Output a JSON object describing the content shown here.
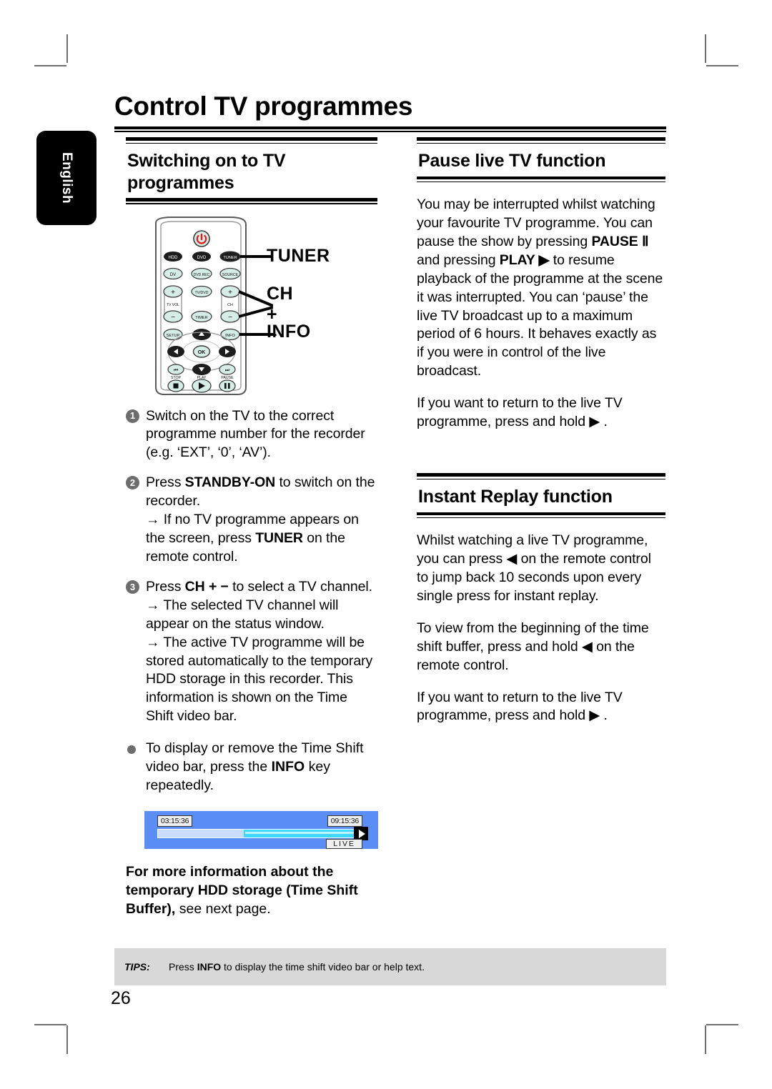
{
  "document": {
    "page_number": "26",
    "language_tab": "English",
    "title": "Control TV programmes"
  },
  "left_column": {
    "section_title": "Switching on to TV programmes",
    "remote": {
      "callouts": [
        "TUNER",
        "CH + −",
        "INFO"
      ],
      "buttons": {
        "row1": [
          "HDD",
          "DVD",
          "TUNER"
        ],
        "row2": [
          "DV",
          "DVD REC",
          "SOURCE"
        ],
        "row3": [
          "+",
          "TV/DVD",
          "+"
        ],
        "row3_labels": [
          "TV VOL",
          "CH"
        ],
        "row4": [
          "−",
          "TIMER",
          "−"
        ],
        "row5": [
          "SETUP",
          "▲",
          "INFO"
        ],
        "nav": [
          "◀",
          "OK",
          "▶"
        ],
        "skip": [
          "⏮",
          "▼",
          "⏭"
        ],
        "transport_labels": [
          "STOP",
          "PLAY",
          "PAUSE"
        ],
        "transport": [
          "■",
          "▶",
          "Ⅱ"
        ]
      }
    },
    "steps": [
      {
        "num": "1",
        "text": "Switch on the TV to the correct programme number for the recorder (e.g. ‘EXT’, ‘0’, ‘AV’)."
      },
      {
        "num": "2",
        "text_parts": {
          "pre": "Press ",
          "bold": "STANDBY-ON",
          "post": " to switch on the recorder."
        },
        "sub": {
          "pre": "→ If no TV programme appears on the screen, press ",
          "bold": "TUNER",
          "post": " on the remote control."
        }
      },
      {
        "num": "3",
        "text_parts": {
          "pre": "Press ",
          "bold": "CH + −",
          "post": " to select a TV channel."
        },
        "sub1": "→ The selected TV channel will appear on the status window.",
        "sub2": "→ The active TV programme will be stored automatically to the temporary HDD storage in this recorder. This information is shown on the Time Shift video bar."
      }
    ],
    "bullet": {
      "pre": "To display or remove the Time Shift video bar, press the ",
      "bold": "INFO",
      "post": " key repeatedly."
    },
    "timeshift_bar": {
      "start_time": "03:15:36",
      "end_time": "09:15:36",
      "live_label": "LIVE",
      "fill_percent": 58,
      "colors": {
        "background": "#5b8ef4",
        "fill": "#3fd8ff",
        "trough": "#c9dcfb"
      }
    },
    "note": {
      "bold": "For more information about the temporary HDD storage (Time Shift Buffer),",
      "normal": " see next page."
    }
  },
  "right_column": {
    "section1": {
      "title": "Pause live TV function",
      "paragraph1_parts": {
        "p1": "You may be interrupted whilst watching your favourite TV programme. You can pause the show by pressing ",
        "b1": "PAUSE Ⅱ",
        "p2": " and pressing ",
        "b2": "PLAY ▶",
        "p3": " to resume playback of the programme at the scene it was interrupted. You can ‘pause’ the live TV broadcast up to a maximum period of 6 hours. It behaves exactly as if you were in control of the live broadcast."
      },
      "paragraph2": "If you want to return to the live TV programme, press and hold ▶ ."
    },
    "section2": {
      "title": "Instant Replay function",
      "paragraph1": "Whilst watching a live TV programme, you can press ◀ on the remote control to jump back 10 seconds upon every single press for instant replay.",
      "paragraph2": "To view from the beginning of the time shift buffer, press and hold ◀ on the remote control.",
      "paragraph3": "If you want to return to the live TV programme, press and hold ▶ ."
    }
  },
  "footer": {
    "tips_label": "TIPS:",
    "tips_pre": "Press ",
    "tips_bold": "INFO",
    "tips_post": " to display the time shift video bar or help text."
  }
}
